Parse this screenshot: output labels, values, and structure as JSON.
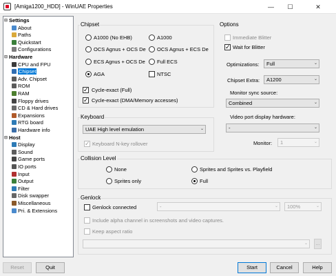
{
  "window": {
    "title": "[Amiga1200_HDD] - WinUAE Properties",
    "minimize_glyph": "—",
    "maximize_glyph": "☐",
    "close_glyph": "✕"
  },
  "tree": {
    "expand_glyph": "⊟",
    "nodes": [
      {
        "label": "Settings",
        "name": "tree-settings",
        "icon": "none",
        "color": "#000000"
      },
      {
        "label": "About",
        "name": "tree-about",
        "icon": "info-icon",
        "color": "#4a8acd"
      },
      {
        "label": "Paths",
        "name": "tree-paths",
        "icon": "folder-icon",
        "color": "#d9a93b"
      },
      {
        "label": "Quickstart",
        "name": "tree-quickstart",
        "icon": "quickstart-icon",
        "color": "#3a7f3a"
      },
      {
        "label": "Configurations",
        "name": "tree-configurations",
        "icon": "config-icon",
        "color": "#7d7d7d"
      },
      {
        "label": "Hardware",
        "name": "tree-hardware",
        "icon": "none",
        "color": "#000000"
      },
      {
        "label": "CPU and FPU",
        "name": "tree-cpu-fpu",
        "icon": "cpu-icon",
        "color": "#3b3b3b"
      },
      {
        "label": "Chipset",
        "name": "tree-chipset",
        "icon": "chip-icon",
        "color": "#2f6db2"
      },
      {
        "label": "Adv. Chipset",
        "name": "tree-adv-chipset",
        "icon": "chip-icon",
        "color": "#5b5b5b"
      },
      {
        "label": "ROM",
        "name": "tree-rom",
        "icon": "rom-icon",
        "color": "#5b5b5b"
      },
      {
        "label": "RAM",
        "name": "tree-ram",
        "icon": "ram-icon",
        "color": "#4d7f2f"
      },
      {
        "label": "Floppy drives",
        "name": "tree-floppy",
        "icon": "floppy-icon",
        "color": "#444444"
      },
      {
        "label": "CD & Hard drives",
        "name": "tree-cd-hd",
        "icon": "drive-icon",
        "color": "#6a6a6a"
      },
      {
        "label": "Expansions",
        "name": "tree-expansions",
        "icon": "expansion-icon",
        "color": "#b05a2a"
      },
      {
        "label": "RTG board",
        "name": "tree-rtg",
        "icon": "rtg-icon",
        "color": "#2e7bb6"
      },
      {
        "label": "Hardware info",
        "name": "tree-hw-info",
        "icon": "info-icon",
        "color": "#3b6ea8"
      },
      {
        "label": "Host",
        "name": "tree-host",
        "icon": "none",
        "color": "#000000"
      },
      {
        "label": "Display",
        "name": "tree-display",
        "icon": "display-icon",
        "color": "#2e7bb6"
      },
      {
        "label": "Sound",
        "name": "tree-sound",
        "icon": "sound-icon",
        "color": "#5d5d5d"
      },
      {
        "label": "Game ports",
        "name": "tree-game-ports",
        "icon": "joystick-icon",
        "color": "#444444"
      },
      {
        "label": "IO ports",
        "name": "tree-io-ports",
        "icon": "port-icon",
        "color": "#555555"
      },
      {
        "label": "Input",
        "name": "tree-input",
        "icon": "input-icon",
        "color": "#b03030"
      },
      {
        "label": "Output",
        "name": "tree-output",
        "icon": "output-icon",
        "color": "#3a7f3a"
      },
      {
        "label": "Filter",
        "name": "tree-filter",
        "icon": "filter-icon",
        "color": "#2e7bb6"
      },
      {
        "label": "Disk swapper",
        "name": "tree-disk-swapper",
        "icon": "swap-icon",
        "color": "#666666"
      },
      {
        "label": "Miscellaneous",
        "name": "tree-misc",
        "icon": "misc-icon",
        "color": "#8a5a2b"
      },
      {
        "label": "Pri. & Extensions",
        "name": "tree-pri-ext",
        "icon": "priority-icon",
        "color": "#4a8acd"
      }
    ]
  },
  "chipset": {
    "title": "Chipset",
    "options": [
      "A1000 (No EHB)",
      "A1000",
      "OCS Agnus + OCS De",
      "OCS Agnus + ECS De",
      "ECS Agnus + OCS De",
      "Full ECS",
      "AGA"
    ],
    "selected": "AGA",
    "ntsc": {
      "label": "NTSC",
      "checked": false
    },
    "cycle_exact_full": {
      "label": "Cycle-exact (Full)",
      "checked": true
    },
    "cycle_exact_dma": {
      "label": "Cycle-exact (DMA/Memory accesses)",
      "checked": true
    }
  },
  "options": {
    "title": "Options",
    "immediate_blitter": {
      "label": "Immediate Blitter",
      "checked": false
    },
    "wait_for_blitter": {
      "label": "Wait for Blitter",
      "checked": true
    },
    "optimizations_label": "Optimizations:",
    "optimizations_value": "Full",
    "chipset_extra_label": "Chipset Extra:",
    "chipset_extra_value": "A1200",
    "monitor_sync_label": "Monitor sync source:",
    "monitor_sync_value": "Combined",
    "video_port_label": "Video port display hardware:",
    "video_port_value": "-",
    "monitor_label": "Monitor:",
    "monitor_value": "1"
  },
  "keyboard": {
    "title": "Keyboard",
    "mode": "UAE High level emulation",
    "nkey": {
      "label": "Keyboard N-key rollover",
      "checked": true
    }
  },
  "collision": {
    "title": "Collision Level",
    "options": [
      "None",
      "Sprites and Sprites vs. Playfield",
      "Sprites only",
      "Full"
    ],
    "selected": "Full"
  },
  "genlock": {
    "title": "Genlock",
    "connected": {
      "label": "Genlock connected",
      "checked": false
    },
    "mode": "-",
    "mix": "100%",
    "alpha": {
      "label": "Include alpha channel in screenshots and video captures.",
      "checked": false
    },
    "aspect": {
      "label": "Keep aspect ratio",
      "checked": false
    },
    "file": "",
    "browse": "..."
  },
  "buttons": {
    "reset": "Reset",
    "quit": "Quit",
    "start": "Start",
    "cancel": "Cancel",
    "help": "Help"
  },
  "glyphs": {
    "dropdown": "⌄"
  }
}
